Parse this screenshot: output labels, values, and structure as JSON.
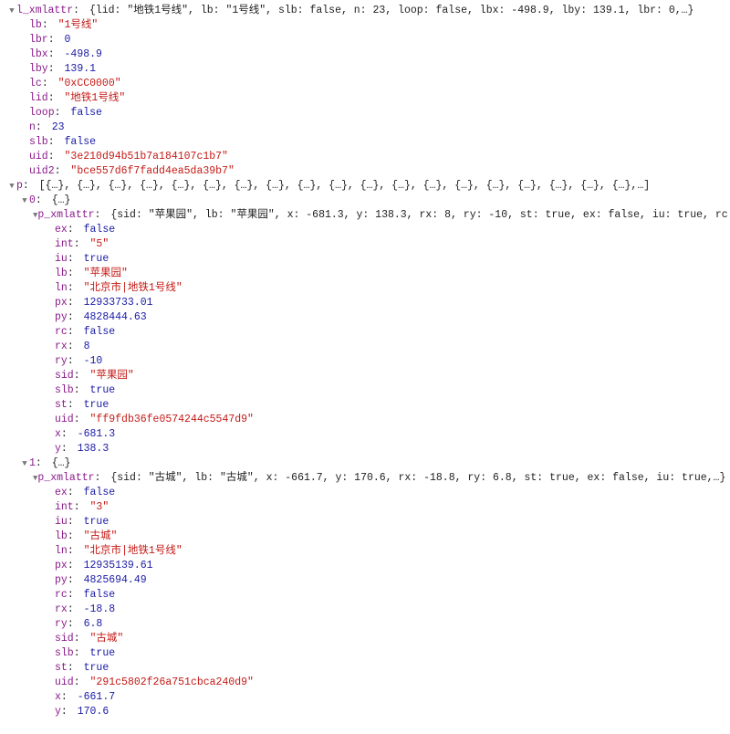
{
  "l_xmlattr": {
    "summary": "{lid: \"地铁1号线\", lb: \"1号线\", slb: false, n: 23, loop: false, lbx: -498.9, lby: 139.1, lbr: 0,…}",
    "fields": [
      {
        "k": "lb",
        "type": "str",
        "v": "1号线"
      },
      {
        "k": "lbr",
        "type": "num",
        "v": "0"
      },
      {
        "k": "lbx",
        "type": "num",
        "v": "-498.9"
      },
      {
        "k": "lby",
        "type": "num",
        "v": "139.1"
      },
      {
        "k": "lc",
        "type": "str",
        "v": "0xCC0000"
      },
      {
        "k": "lid",
        "type": "str",
        "v": "地铁1号线"
      },
      {
        "k": "loop",
        "type": "bool",
        "v": "false"
      },
      {
        "k": "n",
        "type": "num",
        "v": "23"
      },
      {
        "k": "slb",
        "type": "bool",
        "v": "false"
      },
      {
        "k": "uid",
        "type": "str",
        "v": "3e210d94b51b7a184107c1b7"
      },
      {
        "k": "uid2",
        "type": "str",
        "v": "bce557d6f7fadd4ea5da39b7"
      }
    ]
  },
  "p_summary": "[{…}, {…}, {…}, {…}, {…}, {…}, {…}, {…}, {…}, {…}, {…}, {…}, {…}, {…}, {…}, {…}, {…}, {…}, {…},…]",
  "items": [
    {
      "idx": "0",
      "p_summary": "{sid: \"苹果园\", lb: \"苹果园\", x: -681.3, y: 138.3, rx: 8, ry: -10, st: true, ex: false, iu: true, rc: false,…}",
      "fields": [
        {
          "k": "ex",
          "type": "bool",
          "v": "false"
        },
        {
          "k": "int",
          "type": "str",
          "v": "5"
        },
        {
          "k": "iu",
          "type": "bool",
          "v": "true"
        },
        {
          "k": "lb",
          "type": "str",
          "v": "苹果园"
        },
        {
          "k": "ln",
          "type": "str",
          "v": "北京市|地铁1号线"
        },
        {
          "k": "px",
          "type": "num",
          "v": "12933733.01"
        },
        {
          "k": "py",
          "type": "num",
          "v": "4828444.63"
        },
        {
          "k": "rc",
          "type": "bool",
          "v": "false"
        },
        {
          "k": "rx",
          "type": "num",
          "v": "8"
        },
        {
          "k": "ry",
          "type": "num",
          "v": "-10"
        },
        {
          "k": "sid",
          "type": "str",
          "v": "苹果园"
        },
        {
          "k": "slb",
          "type": "bool",
          "v": "true"
        },
        {
          "k": "st",
          "type": "bool",
          "v": "true"
        },
        {
          "k": "uid",
          "type": "str",
          "v": "ff9fdb36fe0574244c5547d9"
        },
        {
          "k": "x",
          "type": "num",
          "v": "-681.3"
        },
        {
          "k": "y",
          "type": "num",
          "v": "138.3"
        }
      ]
    },
    {
      "idx": "1",
      "p_summary": "{sid: \"古城\", lb: \"古城\", x: -661.7, y: 170.6, rx: -18.8, ry: 6.8, st: true, ex: false, iu: true,…}",
      "fields": [
        {
          "k": "ex",
          "type": "bool",
          "v": "false"
        },
        {
          "k": "int",
          "type": "str",
          "v": "3"
        },
        {
          "k": "iu",
          "type": "bool",
          "v": "true"
        },
        {
          "k": "lb",
          "type": "str",
          "v": "古城"
        },
        {
          "k": "ln",
          "type": "str",
          "v": "北京市|地铁1号线"
        },
        {
          "k": "px",
          "type": "num",
          "v": "12935139.61"
        },
        {
          "k": "py",
          "type": "num",
          "v": "4825694.49"
        },
        {
          "k": "rc",
          "type": "bool",
          "v": "false"
        },
        {
          "k": "rx",
          "type": "num",
          "v": "-18.8"
        },
        {
          "k": "ry",
          "type": "num",
          "v": "6.8"
        },
        {
          "k": "sid",
          "type": "str",
          "v": "古城"
        },
        {
          "k": "slb",
          "type": "bool",
          "v": "true"
        },
        {
          "k": "st",
          "type": "bool",
          "v": "true"
        },
        {
          "k": "uid",
          "type": "str",
          "v": "291c5802f26a751cbca240d9"
        },
        {
          "k": "x",
          "type": "num",
          "v": "-661.7"
        },
        {
          "k": "y",
          "type": "num",
          "v": "170.6"
        }
      ]
    }
  ]
}
